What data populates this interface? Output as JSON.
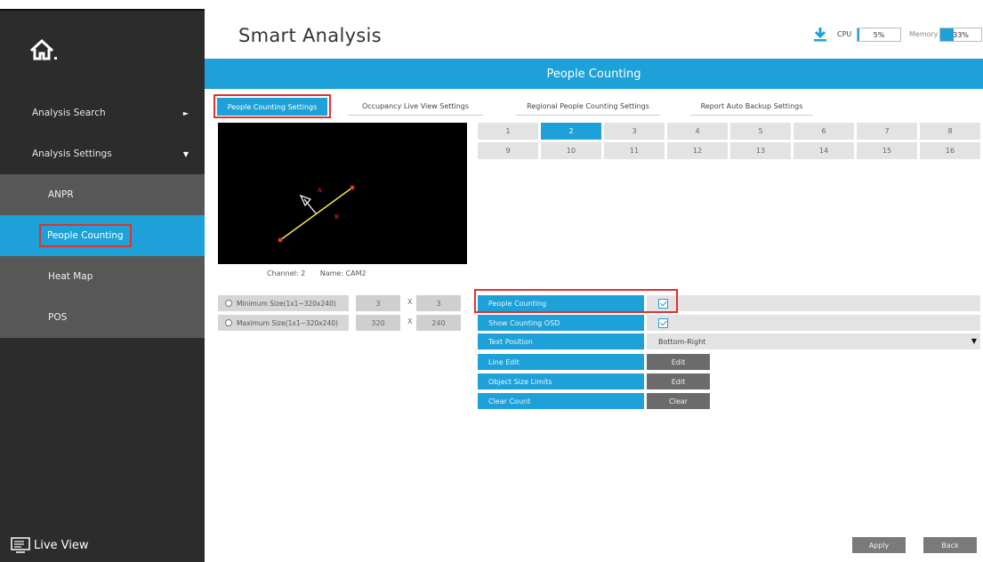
{
  "header": {
    "title": "Smart Analysis",
    "cpu_label": "CPU",
    "cpu_value": "5%",
    "cpu_percent": 5,
    "memory_label": "Memory",
    "memory_value": "33%",
    "memory_percent": 33,
    "download_icon": "download-icon"
  },
  "sidebar": {
    "home_icon": "home-icon",
    "items": [
      {
        "label": "Analysis Search",
        "arrow": "►"
      },
      {
        "label": "Analysis Settings",
        "arrow": "▼"
      }
    ],
    "sub_items": [
      {
        "label": "ANPR"
      },
      {
        "label": "People Counting"
      },
      {
        "label": "Heat Map"
      },
      {
        "label": "POS"
      }
    ],
    "live_view": "Live View"
  },
  "banner": "People Counting",
  "tabs": [
    {
      "label": "People Counting Settings"
    },
    {
      "label": "Occupancy Live View Settings"
    },
    {
      "label": "Regional People Counting Settings"
    },
    {
      "label": "Report Auto Backup Settings"
    }
  ],
  "video": {
    "label_a": "A",
    "label_b": "B",
    "channel": "Channel: 2",
    "name": "Name: CAM2"
  },
  "channels": [
    "1",
    "2",
    "3",
    "4",
    "5",
    "6",
    "7",
    "8",
    "9",
    "10",
    "11",
    "12",
    "13",
    "14",
    "15",
    "16"
  ],
  "selected_channel": "2",
  "sizes": {
    "min_label": "Minimum Size(1x1~320x240)",
    "min_w": "3",
    "min_h": "3",
    "max_label": "Maximum Size(1x1~320x240)",
    "max_w": "320",
    "max_h": "240",
    "x": "X"
  },
  "settings": {
    "people_counting": "People Counting",
    "show_osd": "Show Counting OSD",
    "text_position": "Text Position",
    "text_position_value": "Bottom-Right",
    "line_edit": "Line Edit",
    "line_edit_btn": "Edit",
    "object_size": "Object Size Limits",
    "object_size_btn": "Edit",
    "clear_count": "Clear Count",
    "clear_btn": "Clear"
  },
  "footer": {
    "apply": "Apply",
    "back": "Back"
  },
  "colors": {
    "accent": "#1ea1d8",
    "sidebar": "#2c2c2c",
    "highlight": "#e0322f"
  }
}
